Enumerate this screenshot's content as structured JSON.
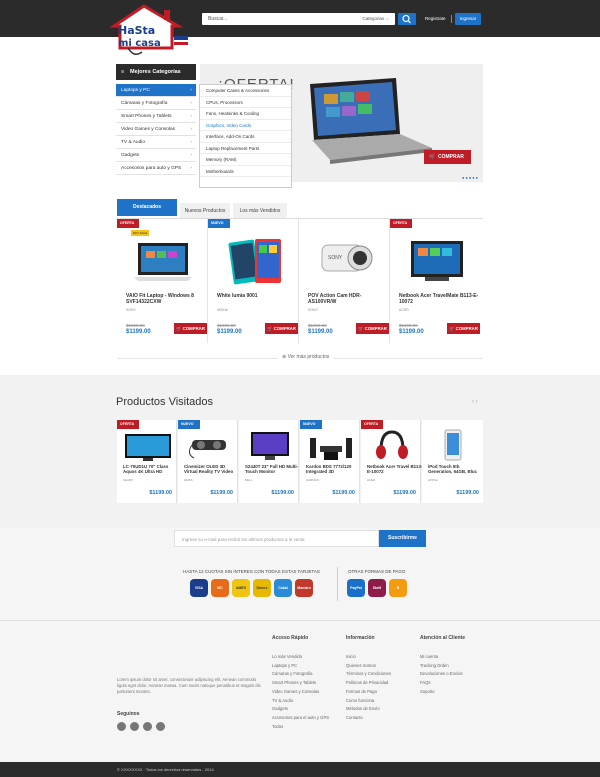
{
  "header": {
    "logo_line1": "HaSta",
    "logo_line2": "mi casa",
    "search_placeholder": "Buscar...",
    "category_select": "Categorias",
    "register": "Registrate",
    "login": "Ingresar"
  },
  "menu": {
    "title": "Mejores Categorías",
    "items": [
      {
        "label": "Laptops y PC",
        "active": true
      },
      {
        "label": "Cámaras y Fotografía"
      },
      {
        "label": "Smart Phones y Tablets"
      },
      {
        "label": "Video Games y Consolas"
      },
      {
        "label": "TV & Audio"
      },
      {
        "label": "Gadgets"
      },
      {
        "label": "Accesorios para auto y GPS"
      }
    ],
    "submenu": [
      "Computer Cases & Accessories",
      "CPUs, Processors",
      "Fans, Heatsinks & Cooling",
      "Graphics, Video Cards",
      "Interface, Add-On Cards",
      "Laptop Replacement Parts",
      "Memory (RAM)",
      "Motherboards"
    ]
  },
  "banner": {
    "title": "¡OFERTA!",
    "button": "COMPRAR"
  },
  "tabs": [
    "Destacados",
    "Nuevos Productos",
    "Los más Vendidos"
  ],
  "featured": [
    {
      "badge": "OFERTA",
      "badge_color": "#c01c25",
      "sale": "30% SALE",
      "name": "VAIO Fit Laptop - Windows 8 SVF14322CXW",
      "brand": "SONY",
      "old": "$1399.00",
      "price": "$1199.00",
      "button": "COMPRAR"
    },
    {
      "badge": "NUEVO",
      "badge_color": "#1e73c9",
      "name": "White lumia 9001",
      "brand": "NOKIA",
      "old": "$1399.00",
      "price": "$1199.00",
      "button": "COMPRAR"
    },
    {
      "name": "POV Action Cam HDR-AS100VR/W",
      "brand": "SONY",
      "old": "$1399.00",
      "price": "$1199.00",
      "button": "COMPRAR"
    },
    {
      "badge": "OFERTA",
      "badge_color": "#c01c25",
      "name": "Netbook Acer TravelMate B113-E-10072",
      "brand": "ACER",
      "old": "$1399.00",
      "price": "$1199.00",
      "button": "COMPRAR"
    }
  ],
  "more_products": "Ver más productos",
  "visited": {
    "title": "Productos Visitados",
    "items": [
      {
        "badge": "OFERTA",
        "badge_color": "#c01c25",
        "name": "LC-70UD1U 70\" Class Aquos 4K Ultra HD",
        "brand": "SHARP",
        "price": "$1199.00"
      },
      {
        "badge": "NUEVO",
        "badge_color": "#1e73c9",
        "name": "Cinemizer OLED 3D Virtual Reality TV Video",
        "brand": "ZEISS",
        "price": "$1199.00"
      },
      {
        "name": "S2440T 23\" Full HD Multi-Touch Monitor",
        "brand": "DELL",
        "price": "$1199.00"
      },
      {
        "badge": "NUEVO",
        "badge_color": "#1e73c9",
        "name": "Kardon BDS 7772/120 Integrated 3D",
        "brand": "HARMAN",
        "price": "$1199.00"
      },
      {
        "badge": "OFERTA",
        "badge_color": "#c01c25",
        "name": "Netbook Acer Travel B113-E-10072",
        "brand": "ACER",
        "price": "$1199.00"
      },
      {
        "name": "iPod Touch 5th Generation, 64GB, Bluc",
        "brand": "APPLE",
        "price": "$1199.00"
      }
    ]
  },
  "newsletter": {
    "placeholder": "Ingrese su e-mail para recibir los ultimos productos a la venta",
    "button": "Suscribirme"
  },
  "payments": {
    "cards_title": "HASTA 12 CUOTAS SIN INTERES CON TODAS ESTAS TARJETAS",
    "cards": [
      "VISA",
      "MC",
      "AMEX",
      "Diners",
      "Cabal",
      "Maestro"
    ],
    "other_title": "OTRAS FORMAS DE PAGO",
    "other": [
      "PayPal",
      "Skrill",
      "B"
    ]
  },
  "footer": {
    "about": "Lorem ipsum dolor sit amet, consectetuer adipiscing elit. Aenean commodo ligula eget dolor. Aenean massa. Cum sociis natoque penatibus et magnis dis parturient montes.",
    "follow": "Seguinos",
    "col1_title": "Acceso Rápido",
    "col1": [
      "Lo más Vendido",
      "Laptops y PC",
      "Cámaras y Fotografía",
      "Smart Phones y Tablets",
      "Video Games y Consolas",
      "TV & Audio",
      "Gadgets",
      "Accesorios para el auto y GPS",
      "Todos"
    ],
    "col2_title": "Información",
    "col2": [
      "Inicio",
      "Quienes Somos",
      "Términos y Condiciones",
      "Políticas de Privacidad",
      "Formas de Pago",
      "Como funciona",
      "Métodos de Envío",
      "Contacto"
    ],
    "col3_title": "Atención al Cliente",
    "col3": [
      "Mi cuenta",
      "Tracking Orden",
      "Devoluciones o Envíos",
      "FAQs",
      "Soporte"
    ],
    "copyright": "© XXXXXXXX · Todos los derechos reservados - 2014"
  }
}
